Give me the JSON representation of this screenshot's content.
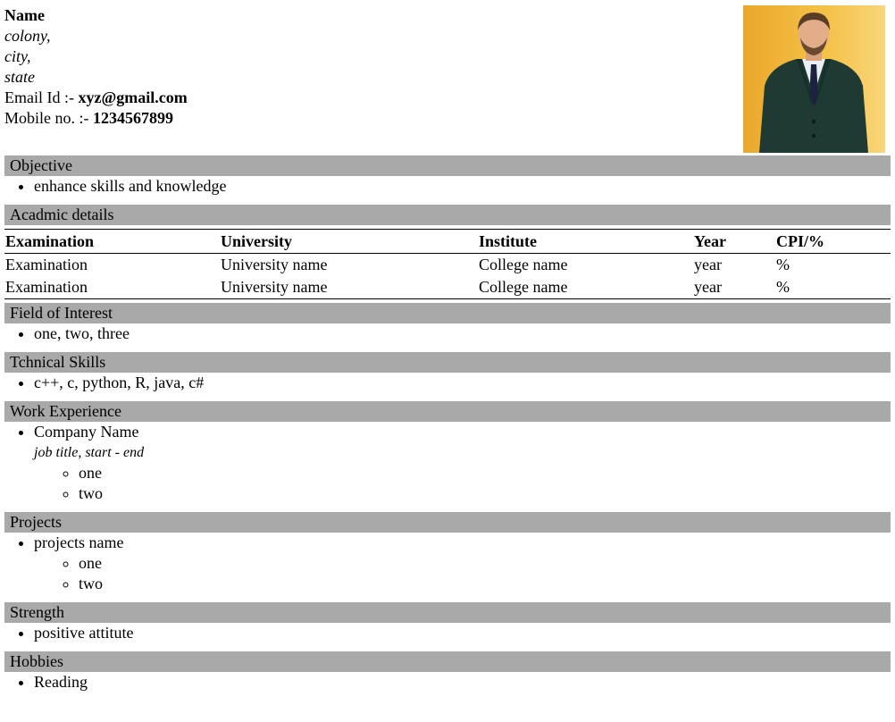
{
  "contact": {
    "name": "Name",
    "address_lines": [
      "colony,",
      "city,",
      "state"
    ],
    "email_label": "Email Id :- ",
    "email": "xyz@gmail.com",
    "mobile_label": "Mobile no. :- ",
    "mobile": "1234567899"
  },
  "sections": {
    "objective": {
      "title": "Objective",
      "items": [
        "enhance skills and knowledge"
      ]
    },
    "academic": {
      "title": "Acadmic details",
      "headers": [
        "Examination",
        "University",
        "Institute",
        "Year",
        "CPI/%"
      ],
      "rows": [
        [
          "Examination",
          "University name",
          "College name",
          "year",
          "%"
        ],
        [
          "Examination",
          "University name",
          "College name",
          "year",
          "%"
        ]
      ]
    },
    "interest": {
      "title": "Field of Interest",
      "items": [
        "one, two, three"
      ]
    },
    "skills": {
      "title": "Tchnical Skills",
      "items": [
        "c++, c, python, R, java, c#"
      ]
    },
    "work": {
      "title": "Work Experience",
      "company": "Company Name",
      "job_title": "job title, start - end",
      "items": [
        "one",
        "two"
      ]
    },
    "projects": {
      "title": "Projects",
      "name": "projects name",
      "items": [
        "one",
        "two"
      ]
    },
    "strength": {
      "title": "Strength",
      "items": [
        "positive attitute"
      ]
    },
    "hobbies": {
      "title": "Hobbies",
      "items": [
        "Reading"
      ]
    }
  },
  "colors": {
    "section_bar": "#a9a9a9",
    "photo_bg": "#f2b83c"
  },
  "icons": {
    "photo": "profile-photo"
  }
}
